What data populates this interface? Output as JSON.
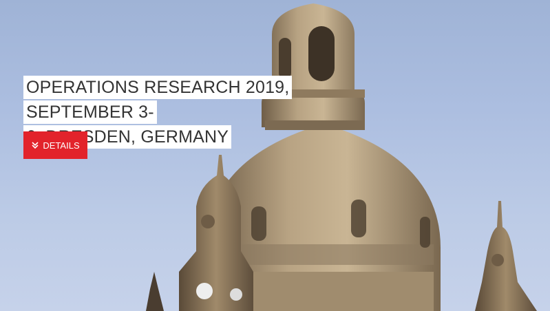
{
  "hero": {
    "title_line1": "OPERATIONS RESEARCH 2019, SEPTEMBER 3-",
    "title_line2": "6, DRESDEN, GERMANY",
    "button_label": "DETAILS",
    "button_icon": "double-chevron-down-icon",
    "accent_color": "#e2232b"
  }
}
